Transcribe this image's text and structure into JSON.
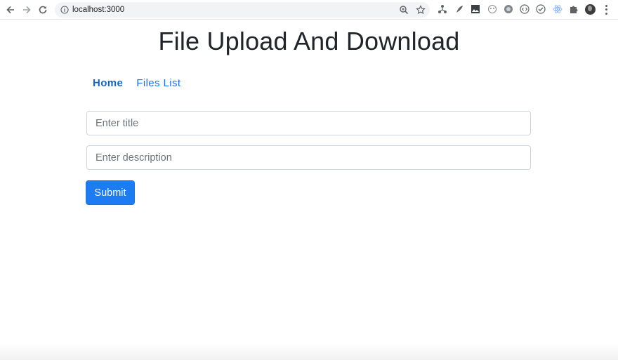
{
  "browser": {
    "url": "localhost:3000",
    "icons": [
      "back-arrow-icon",
      "forward-arrow-icon",
      "reload-icon",
      "site-info-icon",
      "zoom-icon",
      "bookmark-star-icon",
      "extensions-puzzle-icon",
      "profile-avatar",
      "more-menu-icon"
    ]
  },
  "page": {
    "title": "File Upload And Download",
    "nav": {
      "home": "Home",
      "files_list": "Files List"
    },
    "form": {
      "title_placeholder": "Enter title",
      "title_value": "",
      "description_placeholder": "Enter description",
      "description_value": "",
      "submit_label": "Submit"
    }
  },
  "colors": {
    "link": "#1a73e8",
    "primary_button": "#1e7cf2",
    "text": "#212529"
  }
}
